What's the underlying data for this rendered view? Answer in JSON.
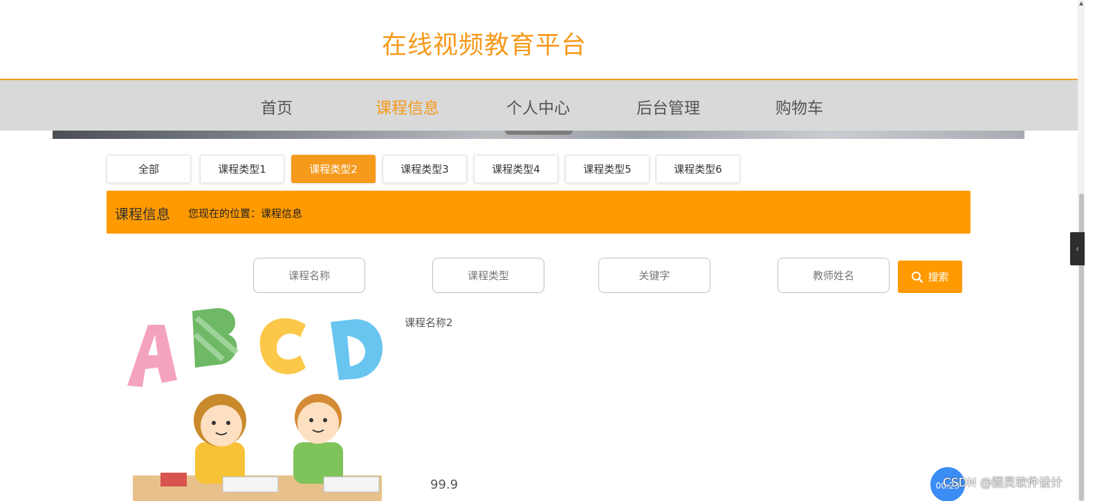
{
  "header": {
    "site_title": "在线视频教育平台"
  },
  "nav": {
    "items": [
      {
        "label": "首页",
        "active": false
      },
      {
        "label": "课程信息",
        "active": true
      },
      {
        "label": "个人中心",
        "active": false
      },
      {
        "label": "后台管理",
        "active": false
      },
      {
        "label": "购物车",
        "active": false
      }
    ]
  },
  "tabs": {
    "items": [
      {
        "label": "全部",
        "active": false
      },
      {
        "label": "课程类型1",
        "active": false
      },
      {
        "label": "课程类型2",
        "active": true
      },
      {
        "label": "课程类型3",
        "active": false
      },
      {
        "label": "课程类型4",
        "active": false
      },
      {
        "label": "课程类型5",
        "active": false
      },
      {
        "label": "课程类型6",
        "active": false
      }
    ]
  },
  "breadcrumb": {
    "title": "课程信息",
    "location": "您现在的位置：课程信息"
  },
  "search": {
    "course_name_placeholder": "课程名称",
    "course_type_placeholder": "课程类型",
    "keyword_placeholder": "关键字",
    "teacher_placeholder": "教师姓名",
    "button_label": "搜索"
  },
  "course": {
    "name": "课程名称2",
    "price": "99.9"
  },
  "overlay": {
    "timer": "00:23",
    "watermark": "CSDN @图灵软件设计"
  },
  "colors": {
    "accent": "#f59a1b",
    "bar": "#ff9a00",
    "nav_bg": "#d9d9d9"
  }
}
